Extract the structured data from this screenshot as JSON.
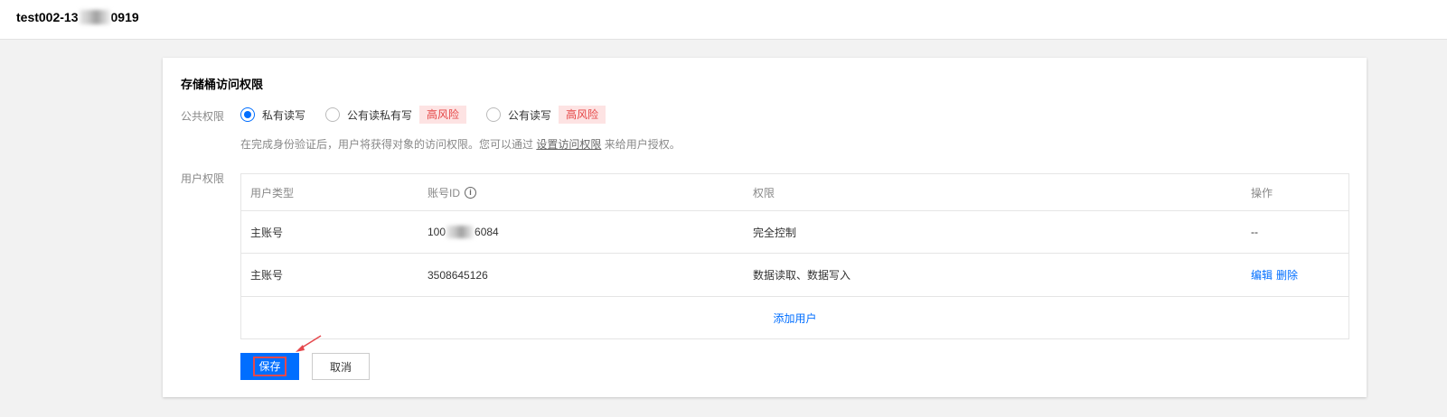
{
  "header": {
    "title_prefix": "test002-13",
    "title_suffix": "0919"
  },
  "section_title": "存储桶访问权限",
  "public": {
    "label": "公共权限",
    "options": [
      {
        "label": "私有读写",
        "checked": true
      },
      {
        "label": "公有读私有写",
        "risk": "高风险"
      },
      {
        "label": "公有读写",
        "risk": "高风险"
      }
    ],
    "hint_prefix": "在完成身份验证后，用户将获得对象的访问权限。您可以通过",
    "hint_link": "设置访问权限",
    "hint_suffix": "来给用户授权。"
  },
  "user": {
    "label": "用户权限",
    "columns": [
      "用户类型",
      "账号ID",
      "权限",
      "操作"
    ],
    "info_icon": "i",
    "rows": [
      {
        "type": "主账号",
        "id_prefix": "100",
        "id_suffix": "6084",
        "permission": "完全控制",
        "action": "--"
      },
      {
        "type": "主账号",
        "id": "3508645126",
        "permission": "数据读取、数据写入",
        "edit": "编辑",
        "delete": "删除"
      }
    ],
    "add_user": "添加用户"
  },
  "buttons": {
    "save": "保存",
    "cancel": "取消"
  },
  "colors": {
    "accent": "#006eff",
    "risk_bg": "#fde3e3",
    "risk_text": "#e54545",
    "annotation": "#e5484d"
  }
}
